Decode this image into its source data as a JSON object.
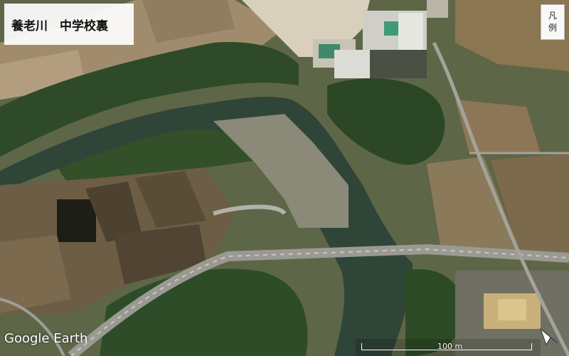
{
  "title": "養老川　中学校裏",
  "legend_button": {
    "line1": "凡",
    "line2": "例"
  },
  "attribution": "Google Earth",
  "scale": {
    "label": "100 m"
  },
  "icons": {
    "compass": "compass-arrow-icon"
  }
}
